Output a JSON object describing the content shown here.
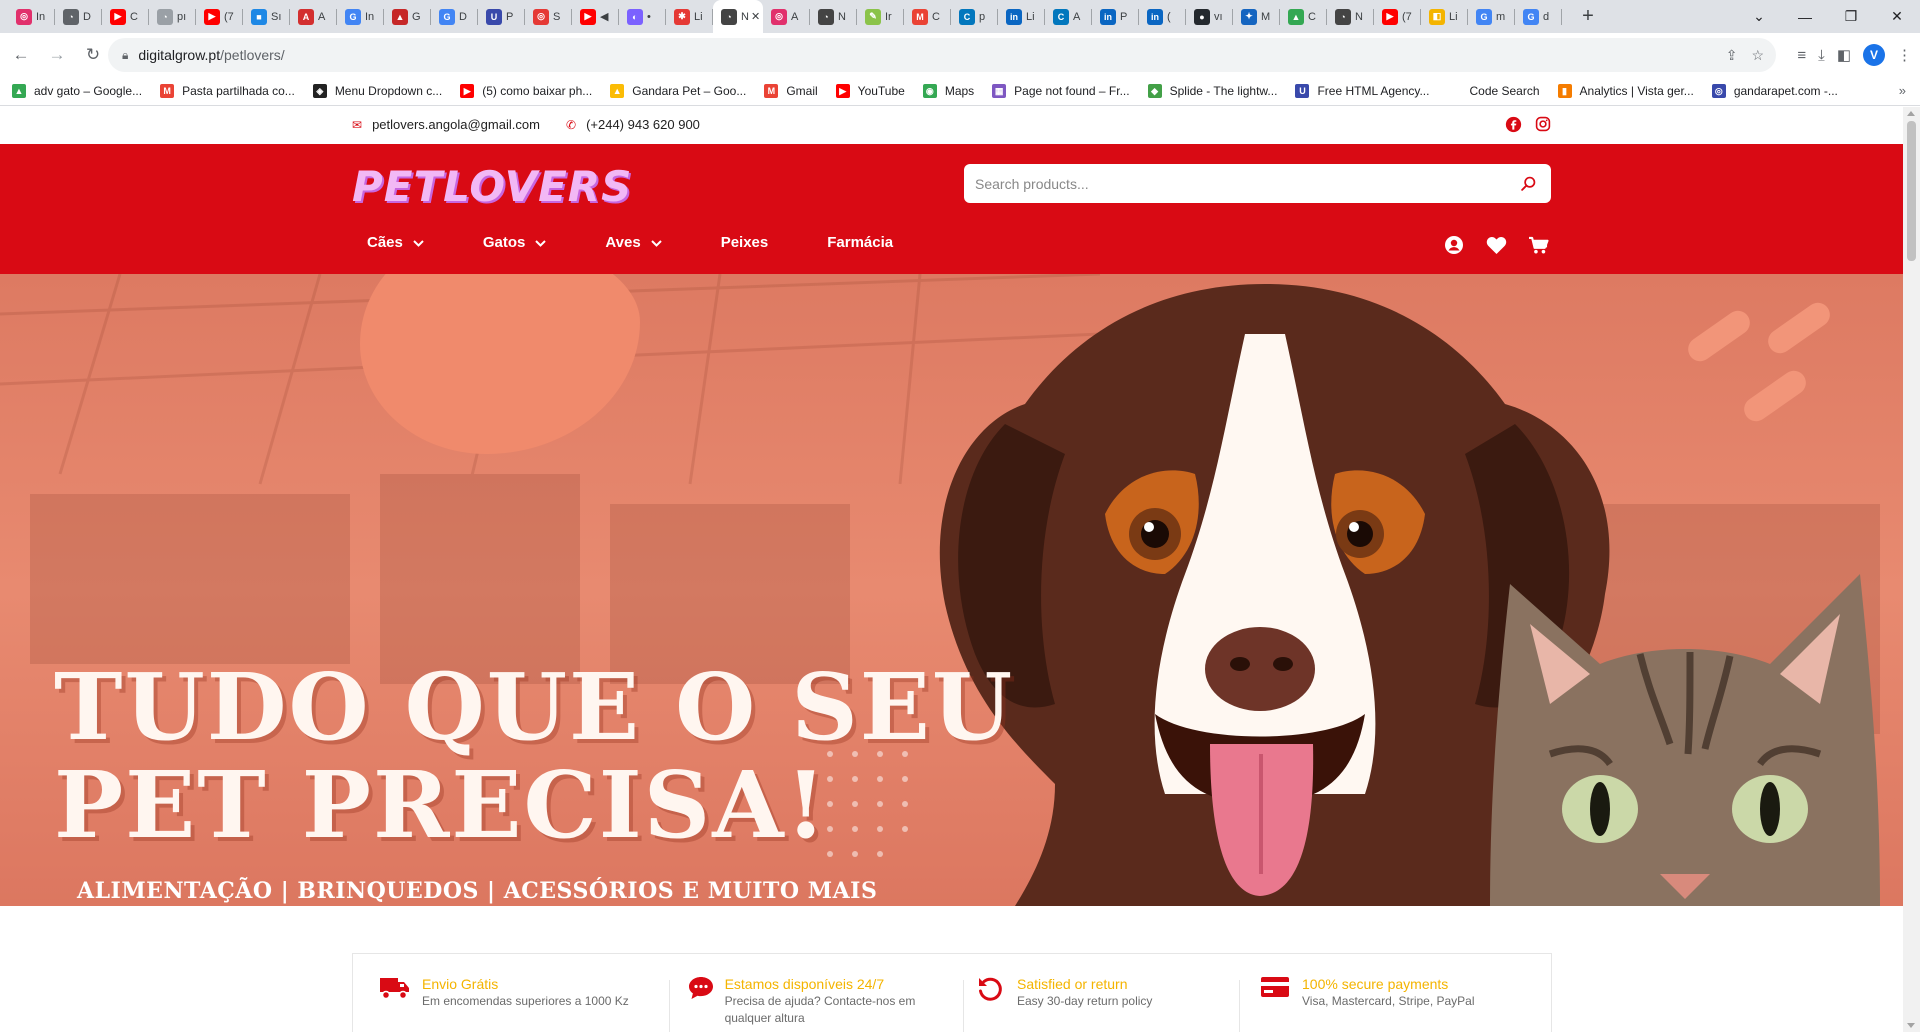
{
  "browser": {
    "tabs": [
      {
        "label": "In",
        "color": "#e1306c",
        "glyph": "◎"
      },
      {
        "label": "D",
        "color": "#5f6368",
        "glyph": "◔"
      },
      {
        "label": "C",
        "color": "#ff0000",
        "glyph": "▶"
      },
      {
        "label": "pı",
        "color": "#9aa0a6",
        "glyph": "◔"
      },
      {
        "label": "(7",
        "color": "#ff0000",
        "glyph": "▶"
      },
      {
        "label": "Sı",
        "color": "#1e88e5",
        "glyph": "■"
      },
      {
        "label": "A",
        "color": "#d32f2f",
        "glyph": "A"
      },
      {
        "label": "In",
        "color": "#4285f4",
        "glyph": "G"
      },
      {
        "label": "G",
        "color": "#c62828",
        "glyph": "▲"
      },
      {
        "label": "D",
        "color": "#4285f4",
        "glyph": "G"
      },
      {
        "label": "P",
        "color": "#3949ab",
        "glyph": "U"
      },
      {
        "label": "S",
        "color": "#e53935",
        "glyph": "◎"
      },
      {
        "label": "◀",
        "color": "#ff0000",
        "glyph": "▶"
      },
      {
        "label": "•",
        "color": "#7b61ff",
        "glyph": "◐"
      },
      {
        "label": "Li",
        "color": "#e53935",
        "glyph": "✱"
      },
      {
        "label": "N",
        "color": "#444",
        "glyph": "◔"
      },
      {
        "label": "A",
        "color": "#e1306c",
        "glyph": "◎"
      },
      {
        "label": "N",
        "color": "#444",
        "glyph": "◔"
      },
      {
        "label": "Ir",
        "color": "#8bc34a",
        "glyph": "✎"
      },
      {
        "label": "C",
        "color": "#ea4335",
        "glyph": "M"
      },
      {
        "label": "p",
        "color": "#0277bd",
        "glyph": "C"
      },
      {
        "label": "Li",
        "color": "#0a66c2",
        "glyph": "in"
      },
      {
        "label": "A",
        "color": "#0277bd",
        "glyph": "C"
      },
      {
        "label": "P",
        "color": "#0a66c2",
        "glyph": "in"
      },
      {
        "label": "(",
        "color": "#0a66c2",
        "glyph": "in"
      },
      {
        "label": "vı",
        "color": "#24292e",
        "glyph": "●"
      },
      {
        "label": "M",
        "color": "#1565c0",
        "glyph": "✦"
      },
      {
        "label": "C",
        "color": "#34a853",
        "glyph": "▲"
      },
      {
        "label": "N",
        "color": "#444",
        "glyph": "◔"
      },
      {
        "label": "(7",
        "color": "#ff0000",
        "glyph": "▶"
      },
      {
        "label": "Li",
        "color": "#f4b400",
        "glyph": "◧"
      },
      {
        "label": "m",
        "color": "#4285f4",
        "glyph": "G"
      },
      {
        "label": "d",
        "color": "#4285f4",
        "glyph": "G"
      }
    ],
    "active_tab_index": 15,
    "url_host": "digitalgrow.pt",
    "url_path": "/petlovers/",
    "profile_initial": "V",
    "bookmarks": [
      {
        "label": "adv gato – Google...",
        "color": "#34a853",
        "glyph": "▲"
      },
      {
        "label": "Pasta partilhada co...",
        "color": "#ea4335",
        "glyph": "M"
      },
      {
        "label": "Menu Dropdown c...",
        "color": "#222",
        "glyph": "◈"
      },
      {
        "label": "(5) como baixar ph...",
        "color": "#ff0000",
        "glyph": "▶"
      },
      {
        "label": "Gandara Pet – Goo...",
        "color": "#fbbc05",
        "glyph": "▲"
      },
      {
        "label": "Gmail",
        "color": "#ea4335",
        "glyph": "M"
      },
      {
        "label": "YouTube",
        "color": "#ff0000",
        "glyph": "▶"
      },
      {
        "label": "Maps",
        "color": "#34a853",
        "glyph": "◉"
      },
      {
        "label": "Page not found – Fr...",
        "color": "#7e57c2",
        "glyph": "▦"
      },
      {
        "label": "Splide - The lightw...",
        "color": "#43a047",
        "glyph": "◆"
      },
      {
        "label": "Free HTML Agency...",
        "color": "#3949ab",
        "glyph": "U"
      },
      {
        "label": "Code Search",
        "color": "#ffffff",
        "glyph": " "
      },
      {
        "label": "Analytics | Vista ger...",
        "color": "#f57c00",
        "glyph": "▮"
      },
      {
        "label": "gandarapet.com -...",
        "color": "#3949ab",
        "glyph": "◎"
      }
    ]
  },
  "site": {
    "email": "petlovers.angola@gmail.com",
    "phone": "(+244) 943 620 900",
    "logo_text": "PETLOVERS",
    "search_placeholder": "Search products...",
    "nav": [
      {
        "label": "Cães",
        "has_dropdown": true
      },
      {
        "label": "Gatos",
        "has_dropdown": true
      },
      {
        "label": "Aves",
        "has_dropdown": true
      },
      {
        "label": "Peixes",
        "has_dropdown": false
      },
      {
        "label": "Farmácia",
        "has_dropdown": false
      }
    ],
    "colors": {
      "brand_red": "#d90a14",
      "accent_yellow": "#f4b400",
      "logo_pink": "#f2b8f5"
    }
  },
  "hero": {
    "title_line1": "TUDO QUE O SEU",
    "title_line2": "PET PRECISA!",
    "subtitle": "ALIMENTAÇÃO | BRINQUEDOS | ACESSÓRIOS E MUITO MAIS"
  },
  "features": [
    {
      "icon": "truck-icon",
      "title": "Envio Grátis",
      "desc": "Em encomendas superiores a 1000 Kz"
    },
    {
      "icon": "chat-icon",
      "title": "Estamos disponíveis 24/7",
      "desc": "Precisa de ajuda? Contacte-nos em qualquer altura"
    },
    {
      "icon": "return-icon",
      "title": "Satisfied or return",
      "desc": "Easy 30-day return policy"
    },
    {
      "icon": "credit-card-icon",
      "title": "100% secure payments",
      "desc": "Visa, Mastercard, Stripe, PayPal"
    }
  ]
}
